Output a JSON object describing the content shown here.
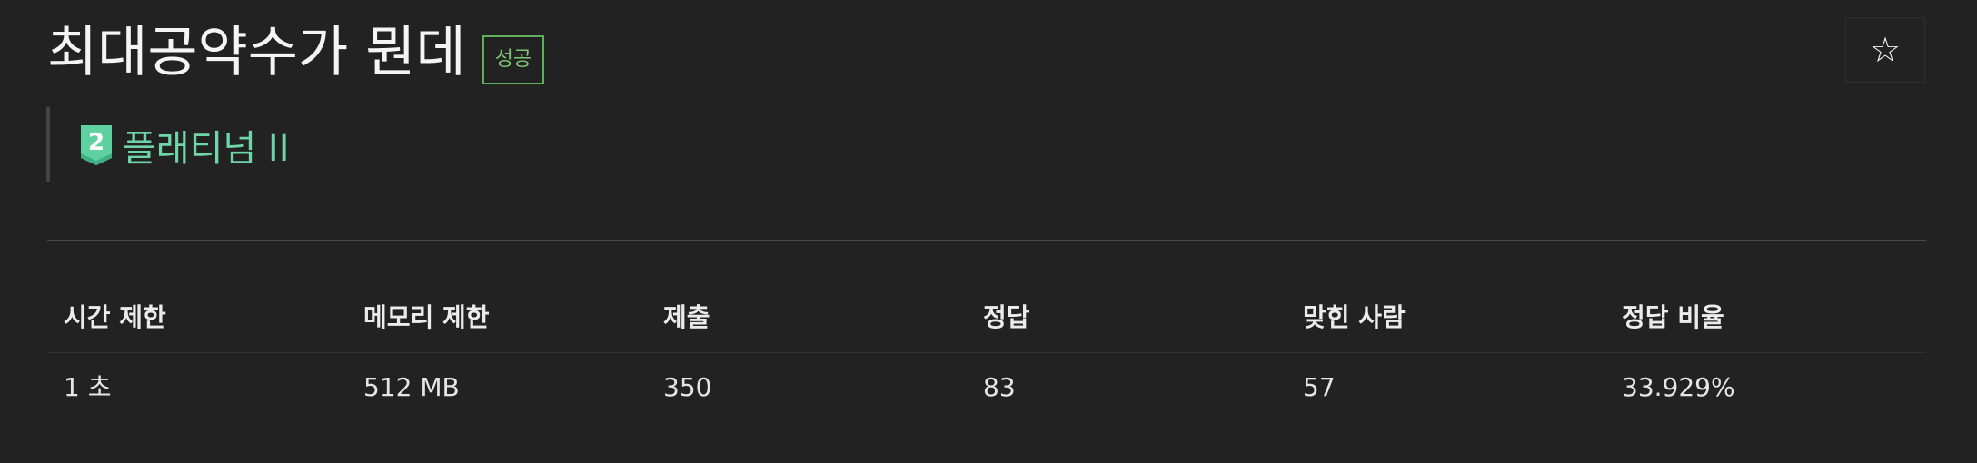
{
  "problem": {
    "title": "최대공약수가 뭔데",
    "status_badge": "성공",
    "tier_number": "2",
    "tier_label": "플래티넘 II"
  },
  "actions": {
    "star_icon": "star-outline-icon",
    "star_glyph": "☆"
  },
  "stats": {
    "headers": [
      "시간 제한",
      "메모리 제한",
      "제출",
      "정답",
      "맞힌 사람",
      "정답 비율"
    ],
    "values": [
      "1 초",
      "512 MB",
      "350",
      "83",
      "57",
      "33.929%"
    ]
  },
  "colors": {
    "background": "#222222",
    "success": "#7cc577",
    "tier_platinum": "#6fd4a8"
  }
}
